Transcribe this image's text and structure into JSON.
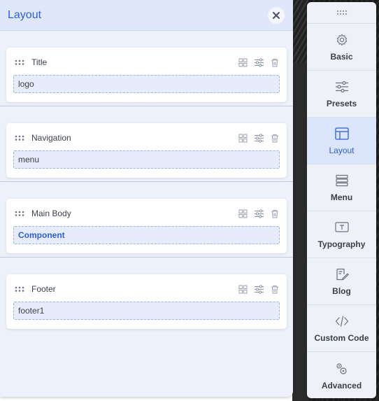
{
  "panel": {
    "title": "Layout",
    "sections": [
      {
        "label": "Title",
        "slot": "logo",
        "active": false
      },
      {
        "label": "Navigation",
        "slot": "menu",
        "active": false
      },
      {
        "label": "Main Body",
        "slot": "Component",
        "active": true
      },
      {
        "label": "Footer",
        "slot": "footer1",
        "active": false
      }
    ]
  },
  "sidebar": {
    "items": [
      {
        "label": "Basic",
        "icon": "gear-icon"
      },
      {
        "label": "Presets",
        "icon": "sliders-icon"
      },
      {
        "label": "Layout",
        "icon": "layout-icon",
        "active": true
      },
      {
        "label": "Menu",
        "icon": "menu-icon"
      },
      {
        "label": "Typography",
        "icon": "typography-icon"
      },
      {
        "label": "Blog",
        "icon": "blog-icon"
      },
      {
        "label": "Custom Code",
        "icon": "code-icon"
      },
      {
        "label": "Advanced",
        "icon": "advanced-icon"
      }
    ]
  },
  "colors": {
    "accent": "#2f5fd6",
    "panel_bg": "#edf1fb",
    "header_bg": "#dfe7fb",
    "slot_bg": "#e7ecfb"
  }
}
